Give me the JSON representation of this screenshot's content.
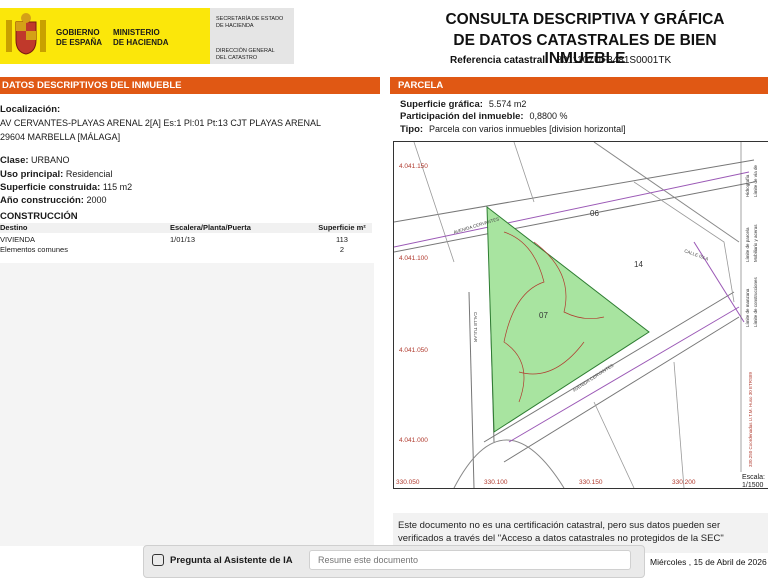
{
  "header": {
    "gov_lines": [
      "GOBIERNO",
      "DE ESPAÑA"
    ],
    "min_lines": [
      "MINISTERIO",
      "DE HACIENDA"
    ],
    "sec_lines": [
      "SECRETARÍA DE ESTADO",
      "DE HACIENDA"
    ],
    "dir_lines": [
      "DIRECCIÓN GENERAL",
      "DEL CATASTRO"
    ],
    "title_line1": "CONSULTA DESCRIPTIVA Y GRÁFICA",
    "title_line2": "DE DATOS CATASTRALES DE BIEN INMUEBLE",
    "ref_label": "Referencia catastral:",
    "ref_value": "8011107UF3481S0001TK"
  },
  "left": {
    "bar_title": "DATOS DESCRIPTIVOS DEL INMUEBLE",
    "localizacion_label": "Localización:",
    "localizacion_line1": "AV CERVANTES-PLAYAS ARENAL 2[A] Es:1 Pl:01 Pt:13 CJT PLAYAS ARENAL",
    "localizacion_line2": "29604 MARBELLA [MÁLAGA]",
    "clase_label": "Clase:",
    "clase_value": "URBANO",
    "uso_label": "Uso principal:",
    "uso_value": "Residencial",
    "superficie_label": "Superficie construida:",
    "superficie_value": "115 m2",
    "anio_label": "Año construcción:",
    "anio_value": "2000",
    "construccion_title": "CONSTRUCCIÓN",
    "table": {
      "headers": {
        "destino": "Destino",
        "escalera": "Escalera/Planta/Puerta",
        "superficie": "Superficie m²"
      },
      "rows": [
        {
          "destino": "VIVIENDA",
          "escalera": "1/01/13",
          "superficie": "113"
        },
        {
          "destino": "Elementos comunes",
          "escalera": "",
          "superficie": "2"
        }
      ]
    }
  },
  "right": {
    "bar_title": "PARCELA",
    "sup_label": "Superficie gráfica:",
    "sup_value": "5.574 m2",
    "part_label": "Participación del inmueble:",
    "part_value": "0,8800 %",
    "tipo_label": "Tipo:",
    "tipo_value": "Parcela con varios inmuebles [division horizontal]",
    "map": {
      "y_labels": [
        "4.041.150",
        "4.041.100",
        "4.041.050",
        "4.041.000"
      ],
      "x_labels": [
        "330.050",
        "330.100",
        "330.150",
        "330.200"
      ],
      "parcel_numbers": [
        "06",
        "14",
        "07"
      ],
      "street_labels": [
        "AVENIDA CERVANTES",
        "AVENIDA CERVANTES",
        "CALLE ISLA",
        "CALLE TULAR"
      ],
      "legend_items": [
        "Hidrografía",
        "Límite de vía de",
        "Mobiliario y aceras",
        "Límite de parcela",
        "Límite de construcciones",
        "Límite de manzana"
      ],
      "escala_label": "Escala:",
      "escala_value": "1/1500",
      "crs_label": "330.250 Coordenadas U.T.M. Huso 30 ETRS89"
    },
    "note": "Este documento no es una certificación catastral, pero sus datos pueden ser verificados a través del \"Acceso a datos catastrales no protegidos de la SEC\""
  },
  "footer": {
    "ai_label": "Pregunta al Asistente de IA",
    "ai_placeholder": "Resume este documento",
    "date": "Miércoles , 15 de Abril de 2026"
  },
  "colors": {
    "accent": "#e05814",
    "parcel_fill": "#a8e4a0",
    "logo_yellow": "#fbe70a"
  }
}
